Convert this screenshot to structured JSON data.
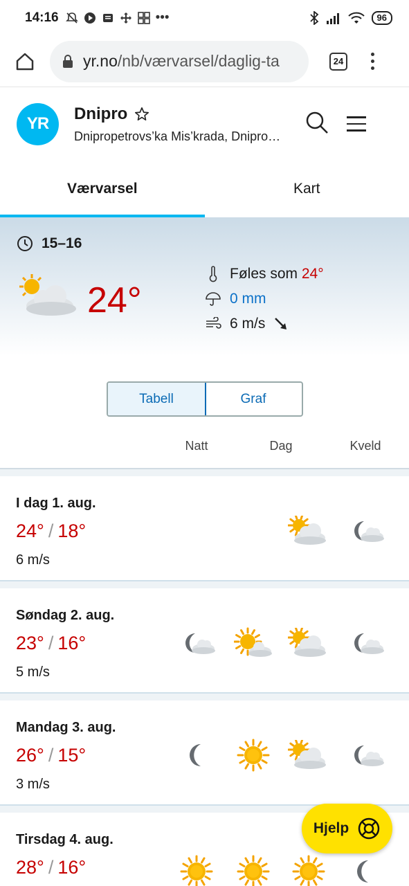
{
  "status_bar": {
    "time": "14:16",
    "battery": "96"
  },
  "browser": {
    "url_host": "yr.no",
    "url_path": "/nb/værvarsel/daglig-ta",
    "tab_count": "24"
  },
  "header": {
    "logo_text": "YR",
    "location_name": "Dnipro",
    "location_sub": "Dnipropetrovs’ka Mis’krada, Dnipro…"
  },
  "tabs": [
    {
      "label": "Værvarsel",
      "active": true
    },
    {
      "label": "Kart",
      "active": false
    }
  ],
  "now": {
    "time_range": "15–16",
    "temperature": "24°",
    "feels_like_label": "Føles som",
    "feels_like_value": "24°",
    "precipitation": "0 mm",
    "wind": "6 m/s",
    "icon": "partly-cloudy-day-icon"
  },
  "view_toggle": [
    {
      "label": "Tabell",
      "active": true
    },
    {
      "label": "Graf",
      "active": false
    }
  ],
  "columns": [
    "Natt",
    "Dag",
    "Kveld"
  ],
  "days": [
    {
      "label": "I dag 1. aug.",
      "max": "24°",
      "min": "18°",
      "wind": "6 m/s",
      "icons": [
        "",
        "",
        "partly-cloudy-day-icon",
        "partly-cloudy-night-icon"
      ]
    },
    {
      "label": "Søndag 2. aug.",
      "max": "23°",
      "min": "16°",
      "wind": "5 m/s",
      "icons": [
        "partly-cloudy-night-icon",
        "fair-day-icon",
        "partly-cloudy-day-icon",
        "partly-cloudy-night-icon"
      ]
    },
    {
      "label": "Mandag 3. aug.",
      "max": "26°",
      "min": "15°",
      "wind": "3 m/s",
      "icons": [
        "clear-night-icon",
        "sun-icon",
        "partly-cloudy-day-icon",
        "partly-cloudy-night-icon"
      ]
    },
    {
      "label": "Tirsdag 4. aug.",
      "max": "28°",
      "min": "16°",
      "wind": "",
      "icons": [
        "sun-icon",
        "sun-icon",
        "sun-icon",
        "clear-night-icon"
      ]
    }
  ],
  "help_button": {
    "label": "Hjelp"
  },
  "colors": {
    "accent": "#00b8f1",
    "temperature": "#c60000",
    "link": "#0b71c8",
    "help": "#ffe100"
  }
}
